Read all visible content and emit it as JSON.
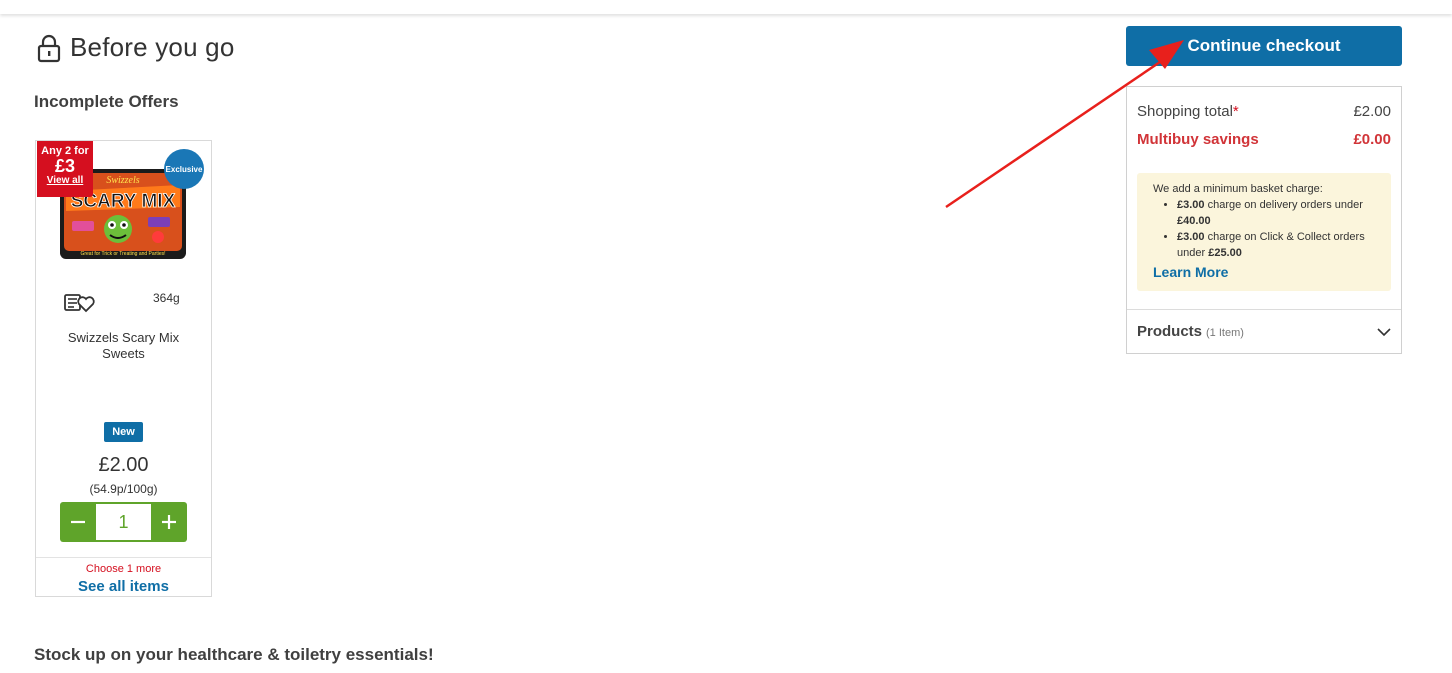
{
  "header": {
    "title": "Before you go",
    "icon": "lock-icon"
  },
  "sections": {
    "incomplete_offers": "Incomplete Offers",
    "stock_up": "Stock up on your healthcare & toiletry essentials!"
  },
  "product": {
    "offer_line1": "Any 2 for",
    "offer_price": "£3",
    "offer_link": "View all",
    "exclusive_badge": "Exclusive",
    "weight": "364g",
    "name": "Swizzels Scary Mix Sweets",
    "new_badge": "New",
    "price": "£2.00",
    "unit_price": "(54.9p/100g)",
    "quantity": "1",
    "choose_more": "Choose 1 more",
    "see_all": "See all items",
    "image_brand": "Swizzels",
    "image_title": "SCARY MIX",
    "image_tagline": "Great for Trick or Treating and Parties!"
  },
  "checkout": {
    "button_label": "Continue checkout",
    "shopping_total_label": "Shopping total",
    "shopping_total_asterisk": "*",
    "shopping_total_value": "£2.00",
    "multibuy_label": "Multibuy savings",
    "multibuy_value": "£0.00",
    "basket_charge_intro": "We add a minimum basket charge:",
    "charge1_amount": "£3.00",
    "charge1_text": " charge on delivery orders under ",
    "charge1_threshold": "£40.00",
    "charge2_amount": "£3.00",
    "charge2_text": " charge on Click & Collect orders under ",
    "charge2_threshold": "£25.00",
    "learn_more": "Learn More",
    "products_label": "Products",
    "products_count": "(1 Item)"
  },
  "colors": {
    "brand_blue": "#0f6ea6",
    "offer_red": "#d50f1f",
    "qty_green": "#5fa42a",
    "info_bg": "#fbf5dc",
    "annotation_arrow": "#e8201c"
  }
}
